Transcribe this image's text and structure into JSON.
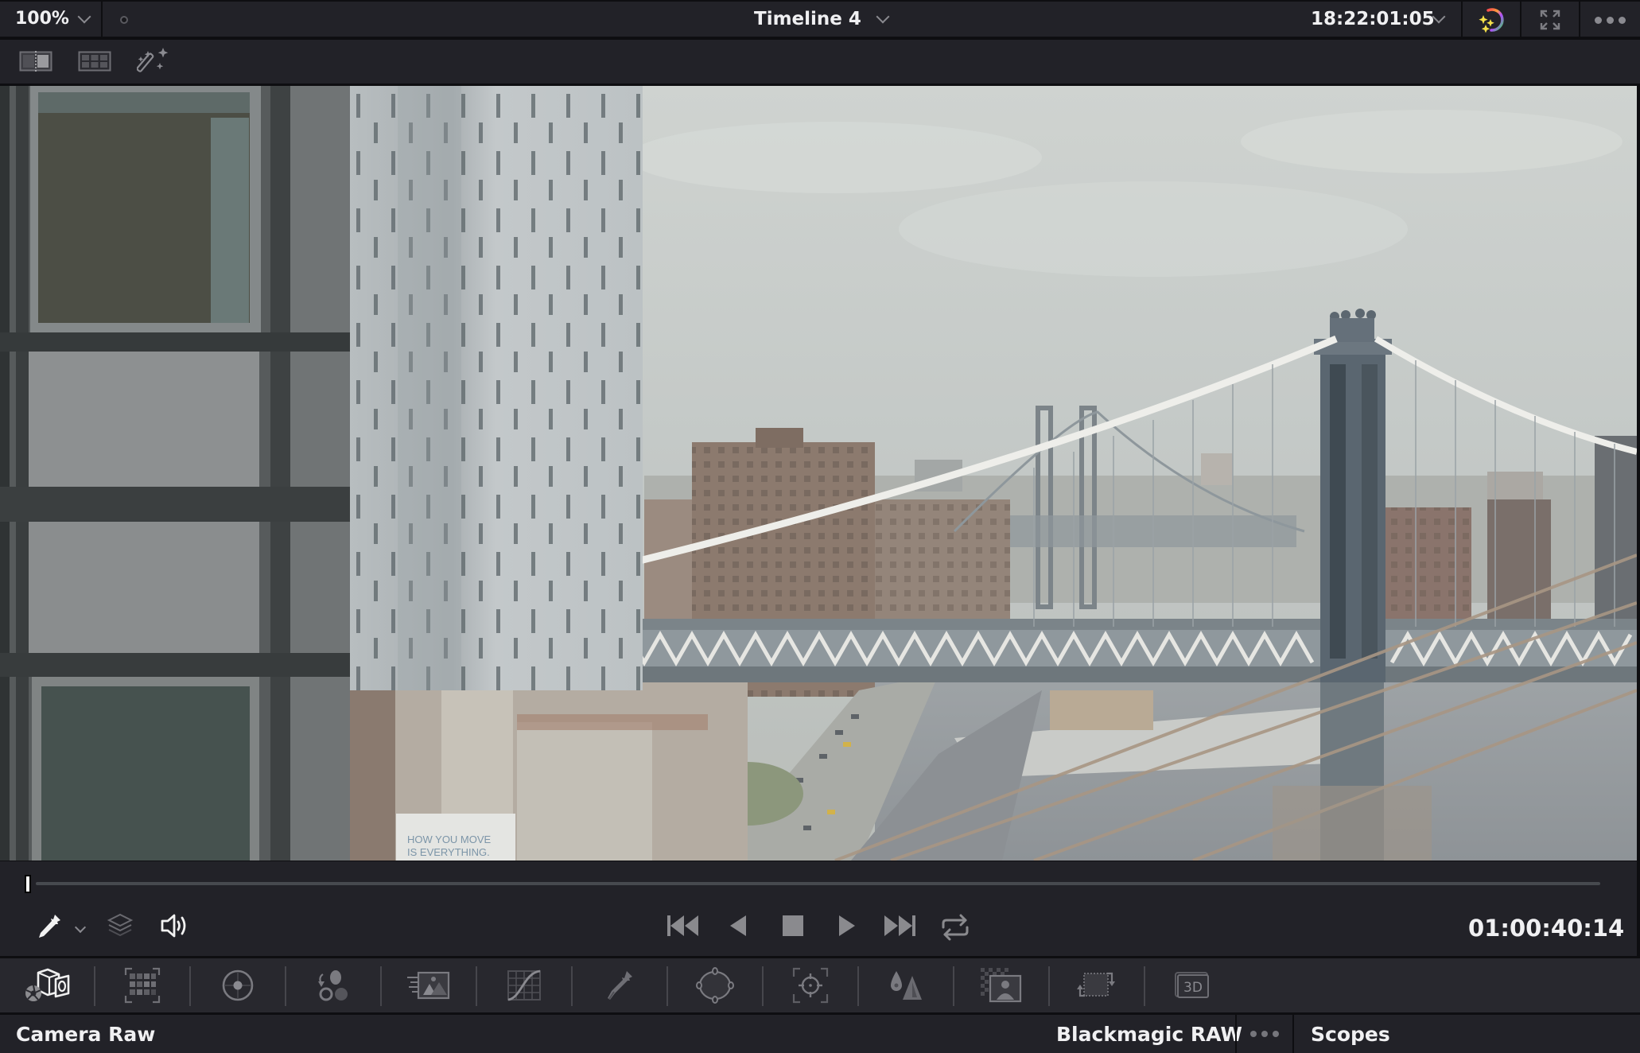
{
  "topbar": {
    "zoom_level": "100%",
    "timeline_name": "Timeline 4",
    "timecode": "18:22:01:05",
    "icons": {
      "zoom_dropdown": "chevron-down-icon",
      "status_dot": "dot-icon",
      "timeline_dropdown": "chevron-down-icon",
      "timecode_dropdown": "chevron-down-icon",
      "color_fx": "magic-color-wheel-icon",
      "fullscreen": "expand-icon",
      "more": "more-options-icon"
    }
  },
  "toolbar2": {
    "icons": [
      "split-screen-icon",
      "gallery-grid-icon",
      "magic-wand-icon"
    ]
  },
  "viewer": {
    "billboard_line1": "HOW YOU MOVE",
    "billboard_line2": "IS EVERYTHING."
  },
  "transport": {
    "playhead_progress": 0.0,
    "icons_left": [
      "eyedropper-icon",
      "chevron-down-icon",
      "layers-icon",
      "speaker-icon"
    ],
    "controls": [
      "skip-to-start-icon",
      "play-reverse-icon",
      "stop-icon",
      "play-icon",
      "skip-to-end-icon",
      "loop-icon"
    ],
    "timecode": "01:00:40:14"
  },
  "palette": {
    "items": [
      {
        "name": "camera-raw-icon",
        "active": true
      },
      {
        "name": "color-match-icon",
        "active": false
      },
      {
        "name": "color-wheels-icon",
        "active": false
      },
      {
        "name": "rgb-mixer-icon",
        "active": false
      },
      {
        "name": "motion-effects-icon",
        "active": false
      },
      {
        "name": "curves-icon",
        "active": false
      },
      {
        "name": "qualifier-icon",
        "active": false
      },
      {
        "name": "window-icon",
        "active": false
      },
      {
        "name": "tracker-icon",
        "active": false
      },
      {
        "name": "blur-icon",
        "active": false
      },
      {
        "name": "key-icon",
        "active": false
      },
      {
        "name": "sizing-icon",
        "active": false
      },
      {
        "name": "3d-icon",
        "active": false,
        "label": "3D"
      }
    ]
  },
  "statusbar": {
    "left_panel_title": "Camera Raw",
    "decoder": "Blackmagic RAW",
    "more_icon": "more-options-icon",
    "right_panel_title": "Scopes"
  },
  "colors": {
    "panel_bg": "#222228",
    "palette_bg": "#28282e",
    "divider": "#0e0e11",
    "text": "#f0f0f2",
    "icon_gray": "#8a8a90"
  }
}
